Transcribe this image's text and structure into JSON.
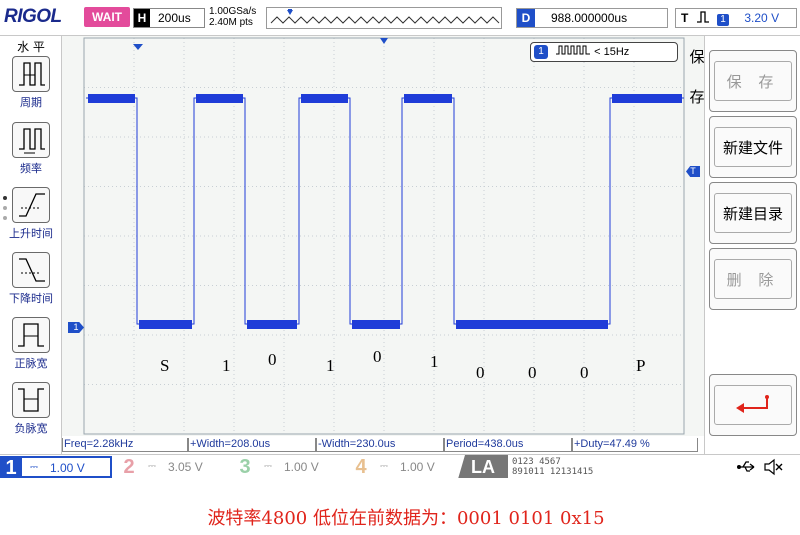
{
  "topbar": {
    "logo": "RIGOL",
    "run_state": "WAIT",
    "h_label": "H",
    "timebase": "200us",
    "sample_rate": "1.00GSa/s",
    "mem_depth": "2.40M pts",
    "delay_label": "D",
    "delay_value": "988.000000us",
    "trigger_label": "T",
    "trigger_channel": "1",
    "trigger_level": "3.20 V"
  },
  "left_panel": {
    "title": "水 平",
    "items": [
      {
        "label": "周期",
        "icon": "period-icon"
      },
      {
        "label": "频率",
        "icon": "frequency-icon"
      },
      {
        "label": "上升时间",
        "icon": "rise-time-icon"
      },
      {
        "label": "下降时间",
        "icon": "fall-time-icon"
      },
      {
        "label": "正脉宽",
        "icon": "positive-width-icon"
      },
      {
        "label": "负脉宽",
        "icon": "negative-width-icon"
      }
    ]
  },
  "display": {
    "channel_marker": "1",
    "trigger_marker": "T",
    "trigger_pos_marker": "T",
    "freq_counter_channel": "1",
    "freq_counter_value": "< 15Hz",
    "trace_color": "#1f3cd8",
    "bit_labels": [
      "S",
      "1",
      "0",
      "1",
      "0",
      "1",
      "0",
      "0",
      "0",
      "P"
    ]
  },
  "right_panel": {
    "title_chars": [
      "保",
      "存"
    ],
    "buttons": [
      {
        "label": "保 存",
        "enabled": false
      },
      {
        "label": "新建文件",
        "enabled": true
      },
      {
        "label": "新建目录",
        "enabled": true
      },
      {
        "label": "删 除",
        "enabled": false
      }
    ],
    "back_icon": "return-arrow-icon"
  },
  "measurements": {
    "freq": "Freq=2.28kHz",
    "pos_width": "+Width=208.0us",
    "neg_width": "-Width=230.0us",
    "period": "Period=438.0us",
    "duty": "+Duty=47.49 %"
  },
  "channels": [
    {
      "num": "1",
      "value": "1.00 V",
      "active": true,
      "color": "#1f4fc8"
    },
    {
      "num": "2",
      "value": "3.05 V",
      "active": false,
      "color": "#e8a0a8"
    },
    {
      "num": "3",
      "value": "1.00 V",
      "active": false,
      "color": "#9ad0a8"
    },
    {
      "num": "4",
      "value": "1.00 V",
      "active": false,
      "color": "#e8c090"
    }
  ],
  "la": {
    "label": "LA",
    "row1": "0123 4567",
    "row2": "891011 12131415"
  },
  "caption": "波特率4800  低位在前数据为：0001 0101 0x15"
}
